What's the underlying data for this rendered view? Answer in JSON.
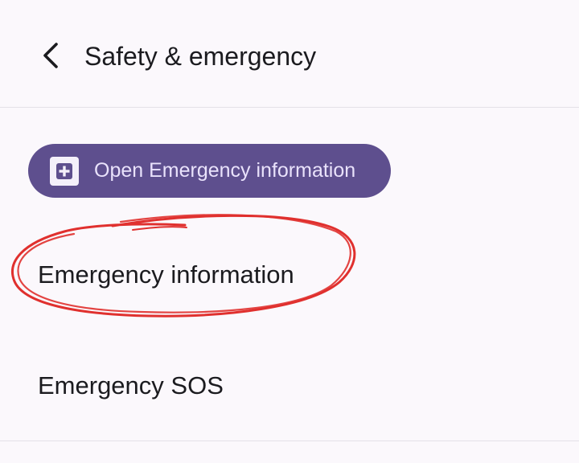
{
  "header": {
    "back_icon": "chevron-left-icon",
    "title": "Safety & emergency"
  },
  "open_emergency_button": {
    "icon": "plus-box-icon",
    "label": "Open Emergency information"
  },
  "list": {
    "items": [
      {
        "label": "Emergency information",
        "highlighted": true
      },
      {
        "label": "Emergency SOS"
      }
    ]
  },
  "colors": {
    "background": "#fbf8fc",
    "button": "#5e4f8e",
    "button_text": "#e9e2fb",
    "annotation": "#e0302e"
  }
}
